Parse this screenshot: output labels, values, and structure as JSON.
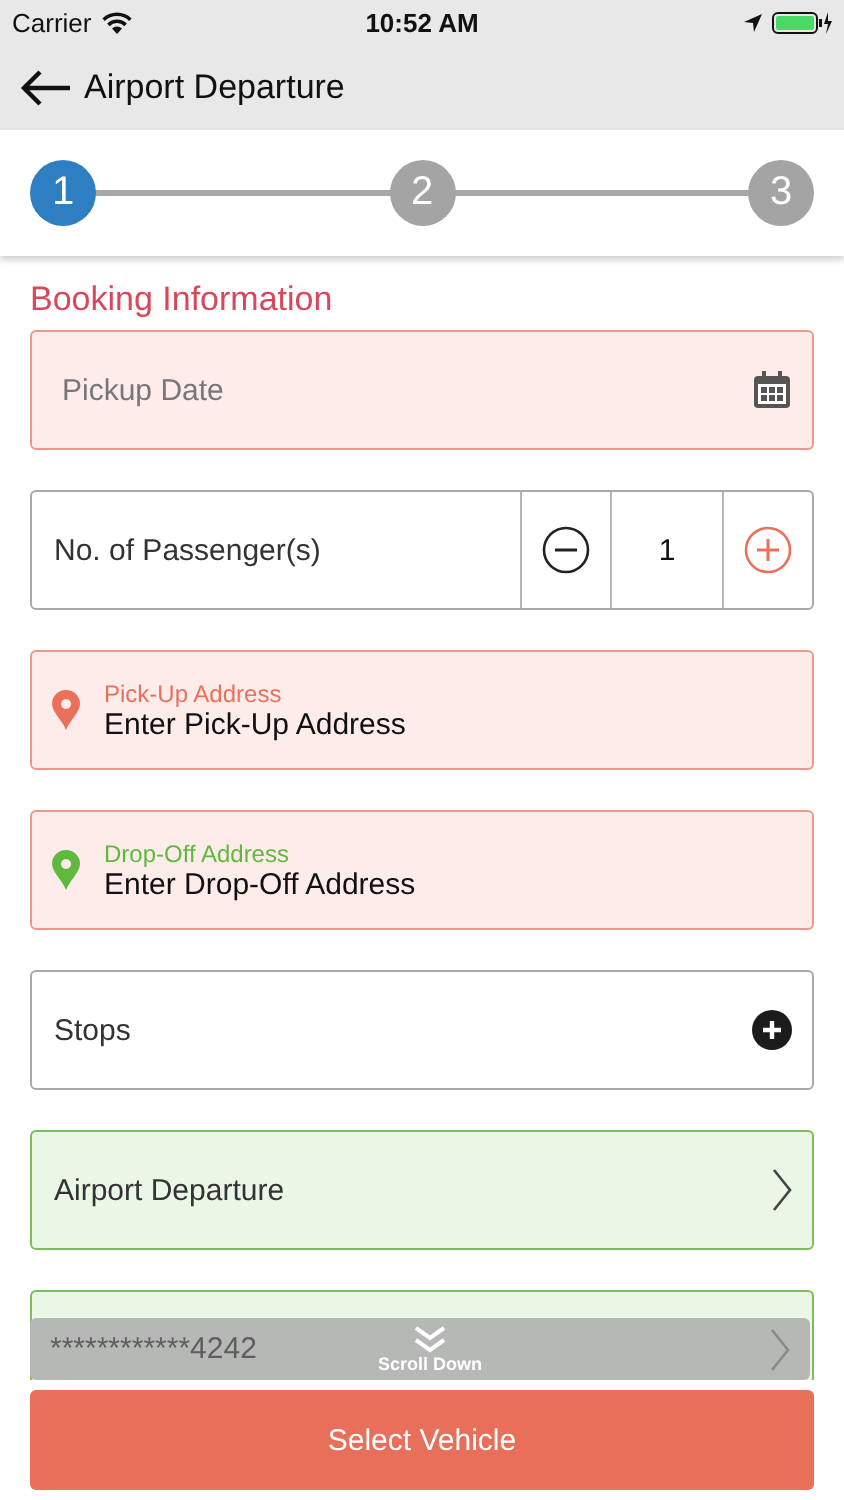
{
  "status_bar": {
    "carrier": "Carrier",
    "time": "10:52 AM"
  },
  "nav": {
    "title": "Airport Departure"
  },
  "steps": [
    {
      "label": "1",
      "selected": true
    },
    {
      "label": "2",
      "selected": false
    },
    {
      "label": "3",
      "selected": false
    }
  ],
  "section_title": "Booking Information",
  "fields": [
    {
      "kind": "date",
      "error": true,
      "valid": false,
      "placeholder": "Pickup Date"
    },
    {
      "kind": "counter",
      "error": false,
      "valid": false,
      "label": "No. of Passenger(s)",
      "value": "1"
    },
    {
      "kind": "address",
      "error": true,
      "valid": false,
      "label": "Pick-Up Address",
      "placeholder": "Enter Pick-Up Address",
      "color": "#e9705a"
    },
    {
      "kind": "address",
      "error": true,
      "valid": false,
      "label": "Drop-Off Address",
      "placeholder": "Enter Drop-Off Address",
      "color": "#5fb93c"
    },
    {
      "kind": "add",
      "error": false,
      "valid": false,
      "label": "Stops"
    },
    {
      "kind": "select",
      "error": false,
      "valid": true,
      "label": "Airport Departure"
    },
    {
      "kind": "select",
      "error": false,
      "valid": true,
      "label": "************4242"
    }
  ],
  "scroll_hint": "Scroll Down",
  "primary_button": "Select Vehicle"
}
